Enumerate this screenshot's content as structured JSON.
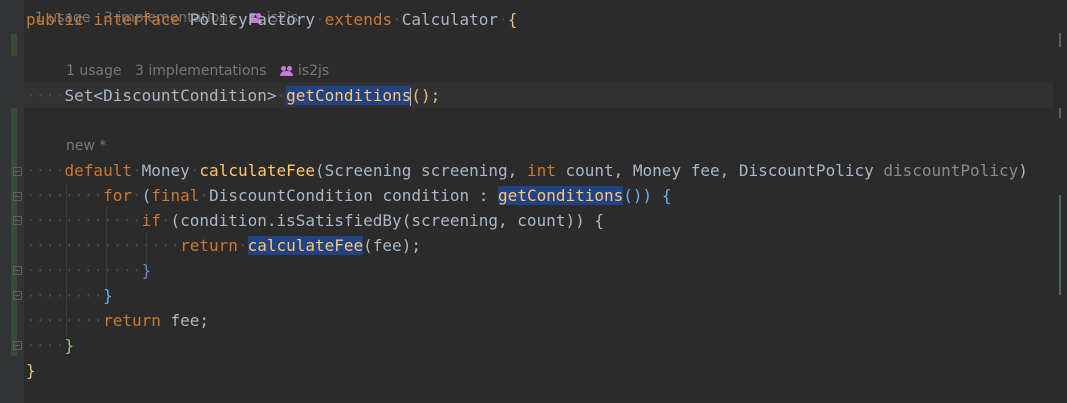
{
  "top_hint": {
    "usages": "1 usage",
    "implementations": "3 implementations",
    "author": "is2js"
  },
  "code": {
    "line1": {
      "kw1": "public",
      "kw2": "interface",
      "name": "PolicyFactory",
      "kw3": "extends",
      "parent": "Calculator",
      "brace": "{"
    },
    "hint2": {
      "usages": "1 usage",
      "implementations": "3 implementations",
      "author": "is2js"
    },
    "line2": {
      "type": "Set<DiscountCondition>",
      "method": "getConditions",
      "tail": "();"
    },
    "hint3": {
      "label": "new *"
    },
    "line3": {
      "kw": "default",
      "ret": "Money",
      "method": "calculateFee",
      "p1": "(Screening screening, ",
      "p2kw": "int",
      "p2": " count, Money fee, DiscountPolicy ",
      "p3": "discountPolicy",
      "close": ")"
    },
    "line4": {
      "kw1": "for",
      "open": "(",
      "kw2": "final",
      "mid": "DiscountCondition condition : ",
      "method": "getConditions",
      "tail": "()) {"
    },
    "line5": {
      "kw": "if",
      "body": "(condition.isSatisfiedBy(screening, count)) {"
    },
    "line6": {
      "kw": "return",
      "method": "calculateFee",
      "tail": "(fee);"
    },
    "line7": {
      "brace": "}"
    },
    "line8": {
      "brace": "}"
    },
    "line9": {
      "kw": "return",
      "tail": " fee;"
    },
    "line10": {
      "brace": "}"
    },
    "line11": {
      "brace": "}"
    }
  }
}
